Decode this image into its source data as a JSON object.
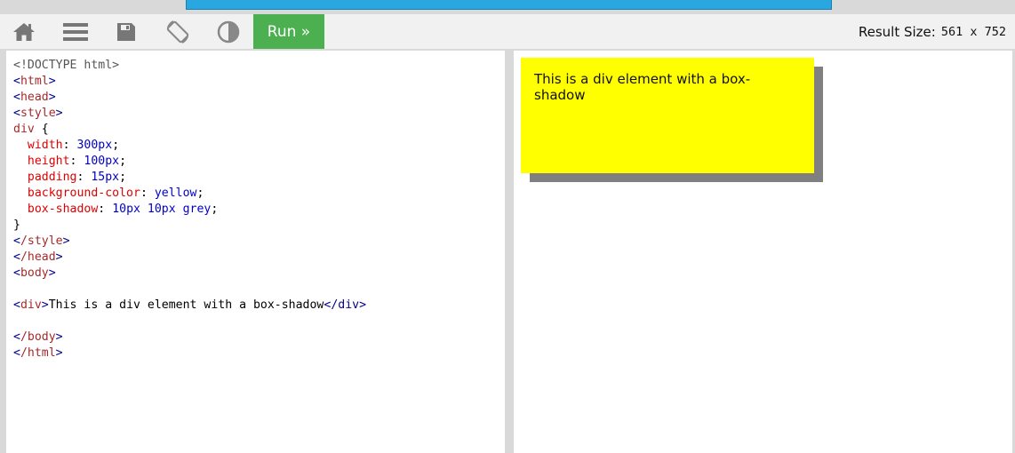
{
  "toolbar": {
    "icons": [
      "home-icon",
      "menu-icon",
      "save-icon",
      "rotate-icon",
      "contrast-icon"
    ],
    "run_label": "Run »",
    "result_size_label": "Result Size:",
    "result_size_value": "561 x 752",
    "colors": {
      "run_bg": "#4caf50",
      "stripe": "#29a7e0"
    }
  },
  "code": {
    "doctype": "<!DOCTYPE html>",
    "html_open": "html",
    "head_open": "head",
    "style_open": "style",
    "selector": "div",
    "props": [
      {
        "name": "width",
        "value": "300px"
      },
      {
        "name": "height",
        "value": "100px"
      },
      {
        "name": "padding",
        "value": "15px"
      },
      {
        "name": "background-color",
        "value": "yellow"
      },
      {
        "name": "box-shadow",
        "value": "10px 10px grey"
      }
    ],
    "style_close": "/style",
    "head_close": "/head",
    "body_open": "body",
    "div_tag": "div",
    "div_text": "This is a div element with a box-shadow",
    "div_close": "/div",
    "body_close": "/body",
    "html_close": "/html"
  },
  "result": {
    "div_text": "This is a div element with a box-shadow"
  }
}
